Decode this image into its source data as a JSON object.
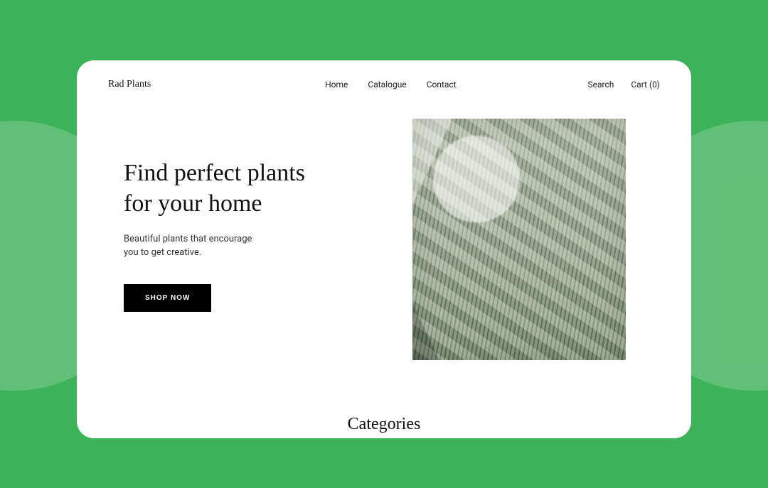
{
  "brand": "Rad Plants",
  "nav": {
    "items": [
      {
        "label": "Home"
      },
      {
        "label": "Catalogue"
      },
      {
        "label": "Contact"
      }
    ],
    "search": "Search",
    "cart": "Cart (0)"
  },
  "hero": {
    "title_line1": "Find perfect plants",
    "title_line2": "for your home",
    "subtitle_line1": "Beautiful plants that encourage",
    "subtitle_line2": "you to get creative.",
    "cta": "SHOP NOW"
  },
  "section": {
    "categories_heading": "Categories"
  }
}
